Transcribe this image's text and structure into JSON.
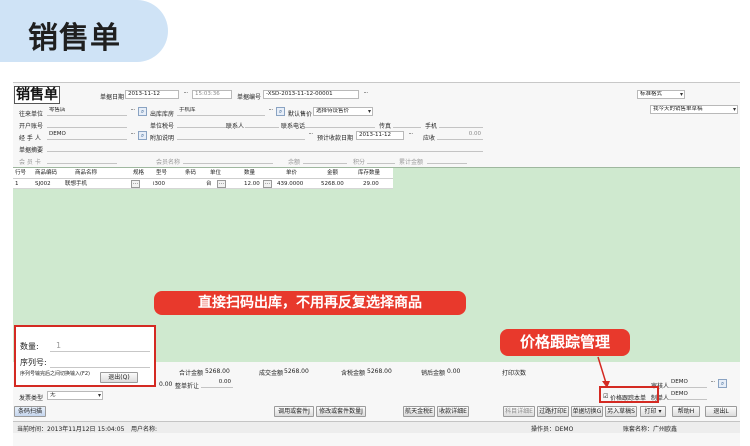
{
  "banner": {
    "title": "销售单"
  },
  "doc": {
    "title": "销售单",
    "date_label": "单据日期",
    "date_value": "2013-11-12",
    "time_value": "15:03:36",
    "number_label": "单据编号",
    "number_value": "-XSD-2013-11-12-00001",
    "format_label": "标准格式",
    "print_template": "我今天的销售单草稿"
  },
  "form": {
    "customer_label": "往来单位",
    "customer_value": "零售店",
    "warehouse_label": "出库库房",
    "warehouse_value": "手机库",
    "price_label": "默认售价",
    "price_value": "选择待设售价",
    "account_label": "开户账号",
    "tax_label": "单位税号",
    "contact_label": "联系人",
    "phone_label": "联系电话",
    "fax_label": "传真",
    "mobile_label": "手机",
    "handler_label": "经 手 人",
    "handler_value": "DEMO",
    "note_label": "附加说明",
    "due_label": "预计收款日期",
    "due_value": "2013-11-12",
    "receipt_label": "应收",
    "receipt_value": "0.00",
    "summary_label": "单据摘要",
    "member_label": "会 员 卡",
    "member_name_label": "会员名称",
    "balance_label": "余额",
    "points_label": "积分",
    "amount_label": "累计金额"
  },
  "grid": {
    "headers": [
      "行号",
      "商品编码",
      "商品名称",
      "规格",
      "型号",
      "条码",
      "单位",
      "数量",
      "单价",
      "金额",
      "库存数量"
    ],
    "rows": [
      {
        "no": "1",
        "code": "SJ002",
        "name": "联想手机",
        "spec": "",
        "model": "i300",
        "barcode": "",
        "unit": "台",
        "qty": "12.00",
        "price": "439.0000",
        "amount": "5268.00",
        "stock": "29.00"
      }
    ]
  },
  "scan_panel": {
    "qty_label": "数量:",
    "qty_value": "1",
    "serial_label": "序列号:",
    "hint": "序列号输完后之间切换输入(F2)",
    "exit_label": "退出(Q)"
  },
  "callouts": {
    "scan": "直接扫码出库，不用再反复选择商品",
    "price": "价格跟踪管理"
  },
  "totals": {
    "total_amount_label": "合计金额",
    "total_amount_value": "5268.00",
    "deal_amount_label": "成交金额",
    "deal_amount_value": "5268.00",
    "tax_amount_label": "含税金额",
    "tax_amount_value": "5268.00",
    "discount_amount_label": "销后金额",
    "discount_amount_value": "0.00",
    "print_count_label": "打印次数",
    "whole_discount_label": "整单折让",
    "whole_discount_value": "0.00",
    "left_value": "0.00",
    "invoice_label": "发票类型",
    "invoice_value": "无",
    "reviewer_label": "审核人",
    "reviewer_value": "DEMO",
    "maker_label": "制单人",
    "maker_value": "DEMO",
    "price_track_label": "价格跟踪本单"
  },
  "buttons": {
    "scan": "条码扫描",
    "import_order": "调用或套件J",
    "modify_order": "修改或套件数量J",
    "apply_pay": "航天金税E",
    "price_detail": "收款详细E",
    "item_detail": "科目详细E",
    "print_prev": "过路打印E",
    "single_switch": "单据切换G",
    "save_draft": "另入草稿S",
    "print": "打印",
    "help": "帮助H",
    "exit": "退出L"
  },
  "status": {
    "time": "当前时间：2013年11月12日 15:04:05",
    "user_name": "用户名称:",
    "operator": "操作员：DEMO",
    "account": "账套名称：广州欧鑫"
  }
}
